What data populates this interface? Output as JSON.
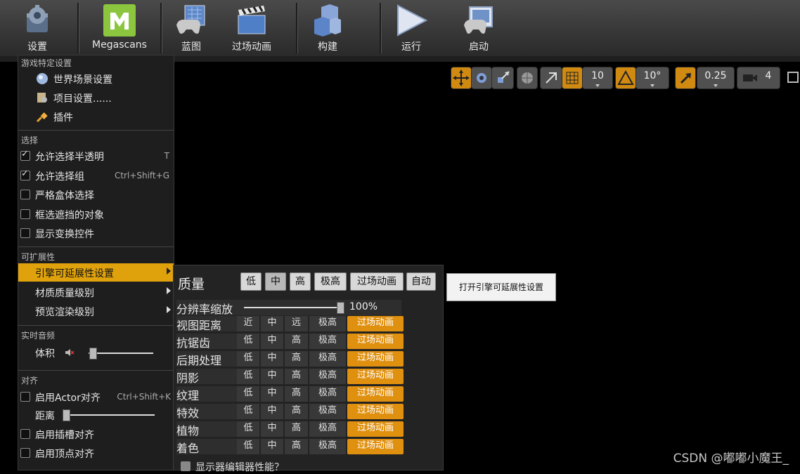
{
  "toolbar": {
    "items": [
      {
        "label": "设置",
        "icon": "gear-icon",
        "dropdown": true
      },
      {
        "label": "Megascans",
        "icon": "megascans-logo-icon",
        "dropdown": false
      },
      {
        "label": "蓝图",
        "icon": "blueprint-gamepad-icon",
        "dropdown": true
      },
      {
        "label": "过场动画",
        "icon": "clapperboard-icon",
        "dropdown": true
      },
      {
        "label": "构建",
        "icon": "build-cubes-icon",
        "dropdown": true
      },
      {
        "label": "运行",
        "icon": "play-icon",
        "dropdown": true
      },
      {
        "label": "启动",
        "icon": "launch-monitor-gamepad-icon",
        "dropdown": true
      }
    ],
    "colors": {
      "accent": "#d08a12",
      "megascans_green": "#8cc63f"
    }
  },
  "viewport_toolbar": {
    "grid_snap": "10",
    "rotation_snap": "10°",
    "scale_snap": "0.25",
    "camera_speed": "4"
  },
  "menu": {
    "game_settings_header": "游戏特定设置",
    "world_settings": "世界场景设置",
    "project_settings": "项目设置......",
    "plugins": "插件",
    "selection_header": "选择",
    "allow_translucent": {
      "label": "允许选择半透明",
      "shortcut": "T",
      "checked": true
    },
    "allow_group": {
      "label": "允许选择组",
      "shortcut": "Ctrl+Shift+G",
      "checked": true
    },
    "strict_box": {
      "label": "严格盒体选择",
      "checked": false
    },
    "box_occluded": {
      "label": "框选遮挡的对象",
      "checked": false
    },
    "show_transform": {
      "label": "显示变换控件",
      "checked": false
    },
    "scalability_header": "可扩展性",
    "engine_scalability": "引擎可延展性设置",
    "material_quality": "材质质量级别",
    "preview_rendering": "预览渲染级别",
    "realtime_audio_header": "实时音频",
    "volume": "体积",
    "volume_level": 0.05,
    "snapping_header": "对齐",
    "enable_actor_snap": {
      "label": "启用Actor对齐",
      "shortcut": "Ctrl+Shift+K",
      "checked": false
    },
    "distance": "距离",
    "distance_level": 0.02,
    "enable_socket_snap": {
      "label": "启用插槽对齐",
      "checked": false
    },
    "enable_vertex_snap": {
      "label": "启用顶点对齐",
      "checked": false
    }
  },
  "quality": {
    "title": "质量",
    "presets": [
      "低",
      "中",
      "高",
      "极高",
      "过场动画",
      "自动"
    ],
    "active_preset": "中",
    "resolution_label": "分辨率缩放",
    "resolution_value": "100%",
    "resolution_level": 1.0,
    "rows": [
      {
        "label": "视图距离",
        "options": [
          "近",
          "中",
          "远",
          "极高",
          "过场动画"
        ],
        "selected": 4
      },
      {
        "label": "抗锯齿",
        "options": [
          "低",
          "中",
          "高",
          "极高",
          "过场动画"
        ],
        "selected": 4
      },
      {
        "label": "后期处理",
        "options": [
          "低",
          "中",
          "高",
          "极高",
          "过场动画"
        ],
        "selected": 4
      },
      {
        "label": "阴影",
        "options": [
          "低",
          "中",
          "高",
          "极高",
          "过场动画"
        ],
        "selected": 4
      },
      {
        "label": "纹理",
        "options": [
          "低",
          "中",
          "高",
          "极高",
          "过场动画"
        ],
        "selected": 4
      },
      {
        "label": "特效",
        "options": [
          "低",
          "中",
          "高",
          "极高",
          "过场动画"
        ],
        "selected": 4
      },
      {
        "label": "植物",
        "options": [
          "低",
          "中",
          "高",
          "极高",
          "过场动画"
        ],
        "selected": 4
      },
      {
        "label": "着色",
        "options": [
          "低",
          "中",
          "高",
          "极高",
          "过场动画"
        ],
        "selected": 4
      }
    ],
    "monitor_editor_perf": "显示器编辑器性能？"
  },
  "tooltip": "打开引擎可延展性设置",
  "watermark": "CSDN @嘟嘟小魔王_"
}
